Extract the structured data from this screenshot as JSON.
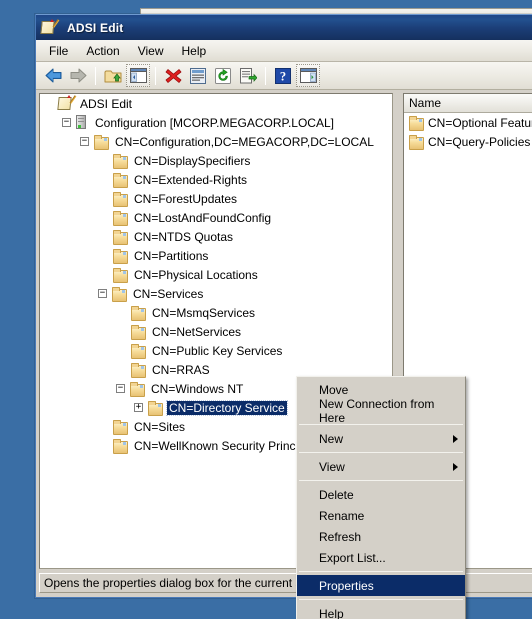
{
  "window": {
    "title": "ADSI Edit",
    "icon": "adsi-edit-icon"
  },
  "menubar": {
    "items": [
      {
        "label": "File"
      },
      {
        "label": "Action"
      },
      {
        "label": "View"
      },
      {
        "label": "Help"
      }
    ]
  },
  "toolbar": {
    "buttons": [
      {
        "name": "back-arrow-icon",
        "title": "Back"
      },
      {
        "name": "forward-arrow-icon",
        "title": "Forward"
      },
      {
        "name": "up-folder-icon",
        "title": "Up One Level"
      },
      {
        "name": "show-hide-console-tree-icon",
        "title": "Show/Hide Console Tree"
      },
      {
        "name": "delete-x-icon",
        "title": "Delete"
      },
      {
        "name": "properties-icon",
        "title": "Properties"
      },
      {
        "name": "refresh-icon",
        "title": "Refresh"
      },
      {
        "name": "export-list-icon",
        "title": "Export List"
      },
      {
        "name": "help-question-icon",
        "title": "Help"
      },
      {
        "name": "show-hide-action-pane-icon",
        "title": "Show/Hide Action Pane"
      }
    ]
  },
  "tree": {
    "nodes": [
      {
        "label": "ADSI Edit",
        "indent": 0,
        "expander": "none",
        "icon": "adsi-edit-icon",
        "selected": false
      },
      {
        "label": "Configuration [MCORP.MEGACORP.LOCAL]",
        "indent": 1,
        "expander": "minus",
        "icon": "server-icon",
        "selected": false
      },
      {
        "label": "CN=Configuration,DC=MEGACORP,DC=LOCAL",
        "indent": 2,
        "expander": "minus",
        "icon": "folder-icon",
        "selected": false
      },
      {
        "label": "CN=DisplaySpecifiers",
        "indent": 3,
        "expander": "none",
        "icon": "folder-icon",
        "selected": false
      },
      {
        "label": "CN=Extended-Rights",
        "indent": 3,
        "expander": "none",
        "icon": "folder-icon",
        "selected": false
      },
      {
        "label": "CN=ForestUpdates",
        "indent": 3,
        "expander": "none",
        "icon": "folder-icon",
        "selected": false
      },
      {
        "label": "CN=LostAndFoundConfig",
        "indent": 3,
        "expander": "none",
        "icon": "folder-icon",
        "selected": false
      },
      {
        "label": "CN=NTDS Quotas",
        "indent": 3,
        "expander": "none",
        "icon": "folder-icon",
        "selected": false
      },
      {
        "label": "CN=Partitions",
        "indent": 3,
        "expander": "none",
        "icon": "folder-icon",
        "selected": false
      },
      {
        "label": "CN=Physical Locations",
        "indent": 3,
        "expander": "none",
        "icon": "folder-icon",
        "selected": false
      },
      {
        "label": "CN=Services",
        "indent": 3,
        "expander": "minus",
        "icon": "folder-icon",
        "selected": false
      },
      {
        "label": "CN=MsmqServices",
        "indent": 4,
        "expander": "none",
        "icon": "folder-icon",
        "selected": false
      },
      {
        "label": "CN=NetServices",
        "indent": 4,
        "expander": "none",
        "icon": "folder-icon",
        "selected": false
      },
      {
        "label": "CN=Public Key Services",
        "indent": 4,
        "expander": "none",
        "icon": "folder-icon",
        "selected": false
      },
      {
        "label": "CN=RRAS",
        "indent": 4,
        "expander": "none",
        "icon": "folder-icon",
        "selected": false
      },
      {
        "label": "CN=Windows NT",
        "indent": 4,
        "expander": "minus",
        "icon": "folder-icon",
        "selected": false
      },
      {
        "label": "CN=Directory Service",
        "indent": 5,
        "expander": "plus",
        "icon": "folder-icon",
        "selected": true
      },
      {
        "label": "CN=Sites",
        "indent": 3,
        "expander": "none",
        "icon": "folder-icon",
        "selected": false
      },
      {
        "label": "CN=WellKnown Security Principals",
        "indent": 3,
        "expander": "none",
        "icon": "folder-icon",
        "selected": false
      }
    ]
  },
  "listview": {
    "columns": [
      "Name"
    ],
    "rows": [
      {
        "name": "CN=Optional Features",
        "icon": "folder-icon"
      },
      {
        "name": "CN=Query-Policies",
        "icon": "folder-icon"
      }
    ]
  },
  "statusbar": {
    "text": "Opens the properties dialog box for the current selection."
  },
  "context_menu": {
    "items": [
      {
        "label": "Move",
        "type": "item"
      },
      {
        "label": "New Connection from Here",
        "type": "item"
      },
      {
        "type": "separator"
      },
      {
        "label": "New",
        "type": "submenu"
      },
      {
        "type": "separator"
      },
      {
        "label": "View",
        "type": "submenu"
      },
      {
        "type": "separator"
      },
      {
        "label": "Delete",
        "type": "item"
      },
      {
        "label": "Rename",
        "type": "item"
      },
      {
        "label": "Refresh",
        "type": "item"
      },
      {
        "label": "Export List...",
        "type": "item"
      },
      {
        "type": "separator"
      },
      {
        "label": "Properties",
        "type": "item",
        "highlighted": true
      },
      {
        "type": "separator"
      },
      {
        "label": "Help",
        "type": "item"
      }
    ]
  },
  "colors": {
    "desktop": "#3a6ea5",
    "titlebar": "#1f4788",
    "selection": "#0b2c68",
    "face": "#d4d0c8"
  }
}
